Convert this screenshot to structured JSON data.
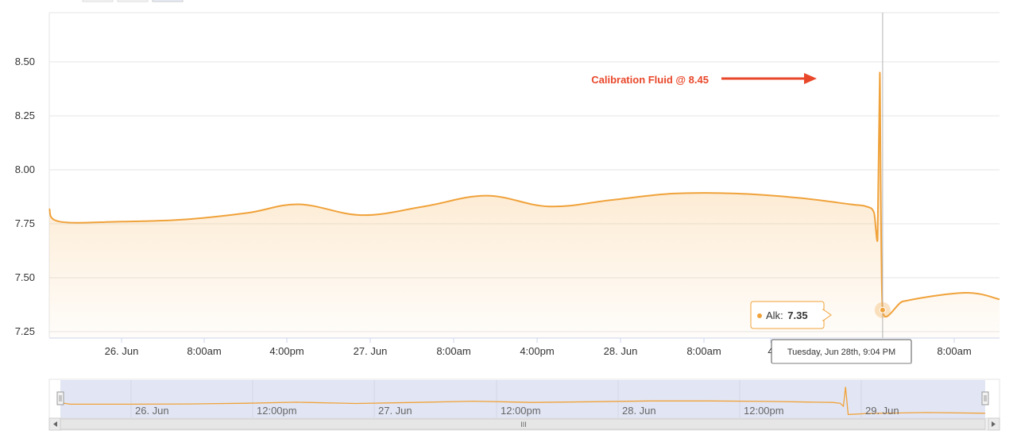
{
  "chart_data": {
    "type": "area",
    "series": [
      {
        "name": "Alk",
        "color": "#f0a23a",
        "x": [
          "2016-06-25T13:00",
          "2016-06-25T14:00",
          "2016-06-25T20:00",
          "2016-06-26T02:00",
          "2016-06-26T08:00",
          "2016-06-26T13:00",
          "2016-06-26T19:00",
          "2016-06-27T01:00",
          "2016-06-27T07:00",
          "2016-06-27T13:00",
          "2016-06-27T19:00",
          "2016-06-28T01:00",
          "2016-06-28T07:00",
          "2016-06-28T13:00",
          "2016-06-28T18:00",
          "2016-06-28T19:30",
          "2016-06-28T20:15",
          "2016-06-28T20:35",
          "2016-06-28T20:48",
          "2016-06-28T21:04",
          "2016-06-28T23:00",
          "2016-06-29T05:00",
          "2016-06-29T11:00"
        ],
        "y": [
          7.82,
          7.76,
          7.76,
          7.77,
          7.8,
          7.84,
          7.79,
          7.83,
          7.88,
          7.83,
          7.86,
          7.89,
          7.89,
          7.87,
          7.84,
          7.83,
          7.8,
          7.68,
          8.45,
          7.35,
          7.39,
          7.43,
          7.4
        ]
      }
    ],
    "y_ticks": [
      "7.25",
      "7.50",
      "7.75",
      "8.00",
      "8.25",
      "8.50"
    ],
    "ylim": [
      7.25,
      8.75
    ],
    "x_ticks": [
      "26. Jun",
      "8:00am",
      "4:00pm",
      "27. Jun",
      "8:00am",
      "4:00pm",
      "28. Jun",
      "8:00am",
      "4",
      "8:00am"
    ],
    "navigator_ticks": [
      "26. Jun",
      "12:00pm",
      "27. Jun",
      "12:00pm",
      "28. Jun",
      "12:00pm",
      "29. Jun"
    ],
    "annotation": {
      "text": "Calibration Fluid @ 8.45",
      "color": "#e8472a"
    },
    "tooltip": {
      "series_label": "Alk",
      "value": "7.35",
      "header": "Tuesday, Jun 28th, 9:04 PM"
    },
    "grid": true,
    "scrollbar_grip": "III"
  }
}
